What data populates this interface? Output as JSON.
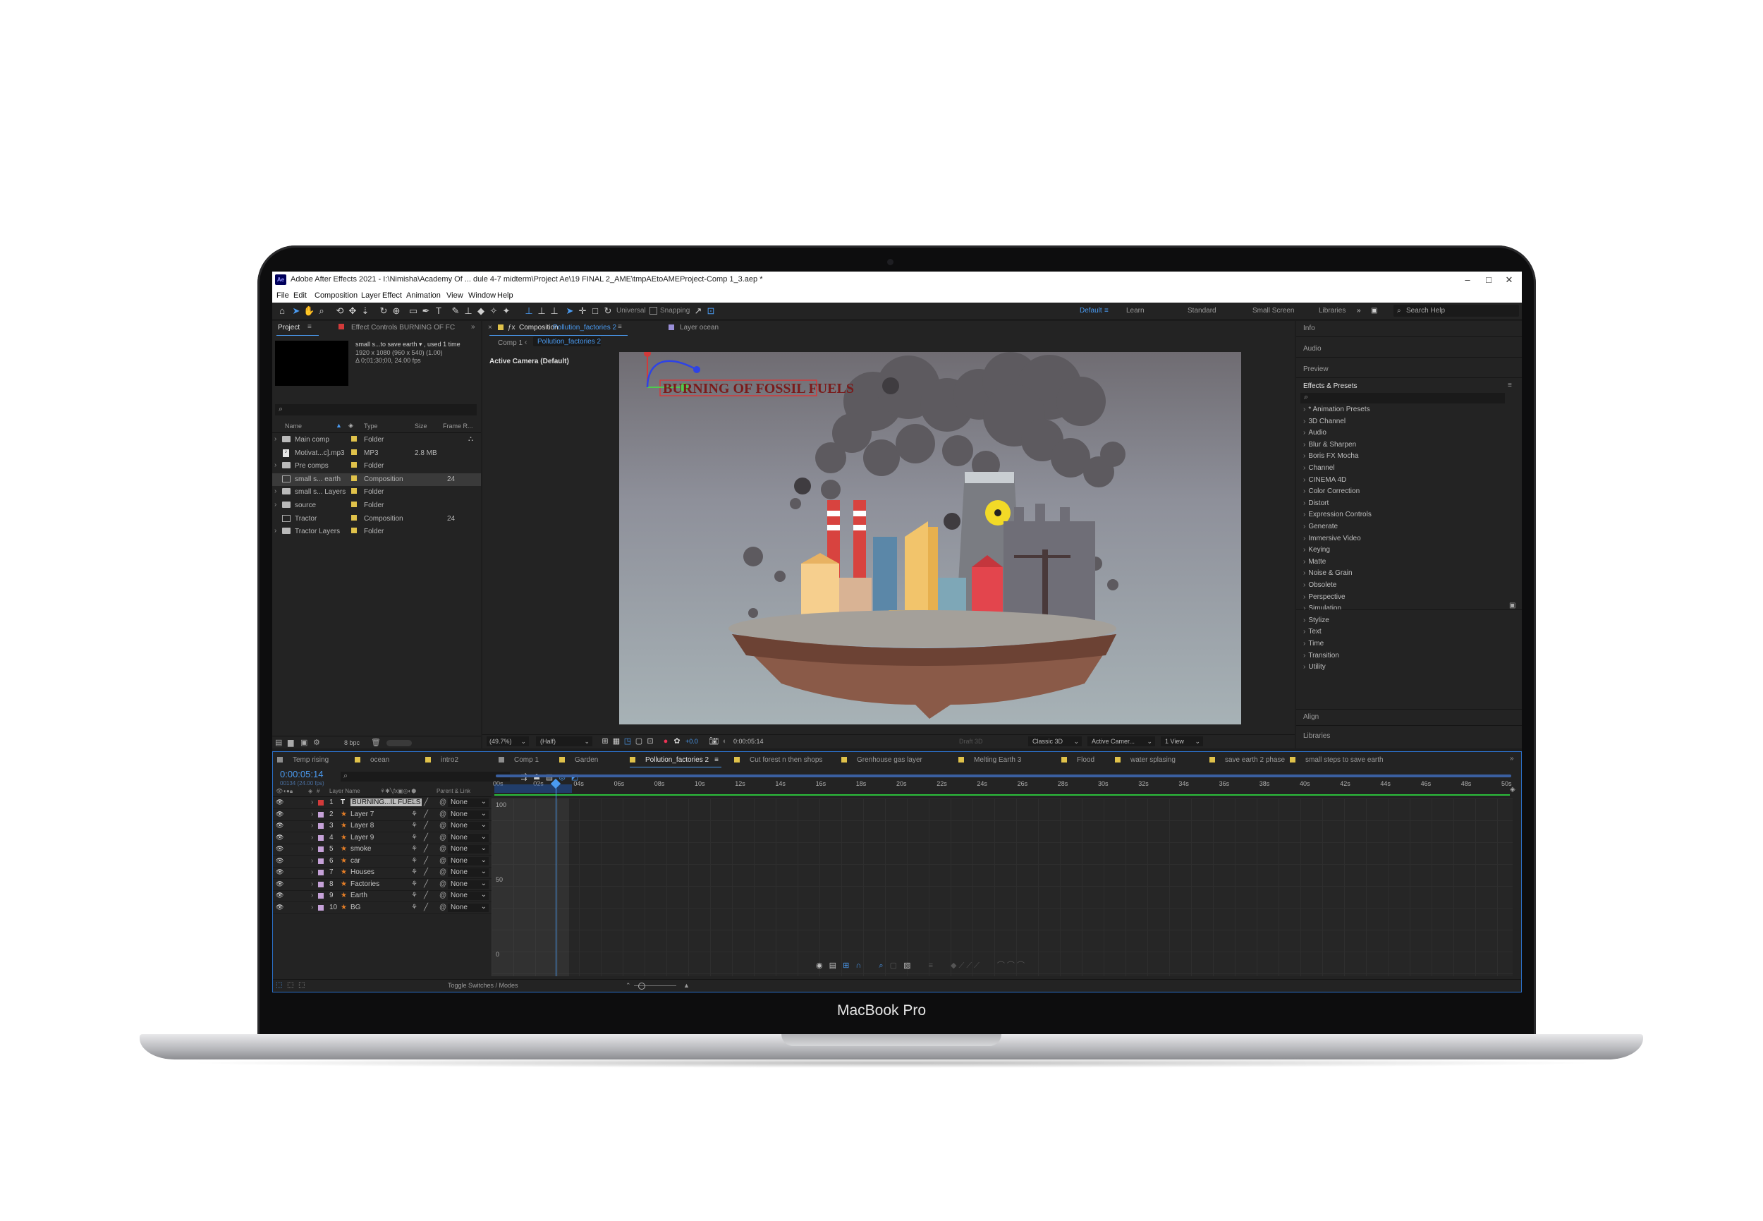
{
  "device": {
    "label": "MacBook Pro"
  },
  "window": {
    "app_icon": "Ae",
    "title": "Adobe After Effects 2021 - I:\\Nimisha\\Academy Of ... dule 4-7 midterm\\Project Ae\\19 FINAL 2_AME\\tmpAEtoAMEProject-Comp 1_3.aep *",
    "minimize": "–",
    "maximize": "□",
    "close": "✕"
  },
  "menu": [
    "File",
    "Edit",
    "Composition",
    "Layer",
    "Effect",
    "Animation",
    "View",
    "Window",
    "Help"
  ],
  "toolbar": {
    "universal": "Universal",
    "snapping": "Snapping",
    "workspaces": [
      "Default",
      "Learn",
      "Standard",
      "Small Screen",
      "Libraries"
    ],
    "search_placeholder": "Search Help"
  },
  "project": {
    "tab_project": "Project",
    "tab_effect_controls": "Effect Controls BURNING OF FC",
    "info_name": "small s...to save earth ▾ , used 1 time",
    "info_size": "1920 x 1080 (960 x 540) (1.00)",
    "info_duration": "Δ 0;01;30;00, 24.00 fps",
    "columns": [
      "Name",
      "Type",
      "Size",
      "Frame R..."
    ],
    "items": [
      {
        "name": "Main comp",
        "type": "Folder",
        "size": "",
        "rate": "",
        "kind": "folder"
      },
      {
        "name": "Motivat...c].mp3",
        "type": "MP3",
        "size": "2.8 MB",
        "rate": "",
        "kind": "file"
      },
      {
        "name": "Pre comps",
        "type": "Folder",
        "size": "",
        "rate": "",
        "kind": "folder"
      },
      {
        "name": "small s... earth",
        "type": "Composition",
        "size": "",
        "rate": "24",
        "kind": "comp"
      },
      {
        "name": "small s... Layers",
        "type": "Folder",
        "size": "",
        "rate": "",
        "kind": "folder"
      },
      {
        "name": "source",
        "type": "Folder",
        "size": "",
        "rate": "",
        "kind": "folder"
      },
      {
        "name": "Tractor",
        "type": "Composition",
        "size": "",
        "rate": "24",
        "kind": "comp"
      },
      {
        "name": "Tractor Layers",
        "type": "Folder",
        "size": "",
        "rate": "",
        "kind": "folder"
      }
    ],
    "bpc": "8 bpc"
  },
  "composition": {
    "tab_prefix": "Composition",
    "tab_name": "Pollution_factories 2",
    "layer_tab": "Layer ocean",
    "breadcrumb": [
      "Comp 1",
      "Pollution_factories 2"
    ],
    "camera_label": "Active Camera (Default)",
    "artwork_title": "BURNING OF FOSSIL FUELS",
    "zoom": "(49.7%)",
    "resolution": "(Half)",
    "exposure": "+0.0",
    "timecode": "0:00:05:14",
    "draft3d": "Draft 3D",
    "renderer": "Classic 3D",
    "camera_select": "Active Camer...",
    "view_select": "1 View"
  },
  "right_panels": {
    "top": [
      "Info",
      "Audio",
      "Preview"
    ],
    "effects_title": "Effects & Presets",
    "effects": [
      "* Animation Presets",
      "3D Channel",
      "Audio",
      "Blur & Sharpen",
      "Boris FX Mocha",
      "Channel",
      "CINEMA 4D",
      "Color Correction",
      "Distort",
      "Expression Controls",
      "Generate",
      "Immersive Video",
      "Keying",
      "Matte",
      "Noise & Grain",
      "Obsolete",
      "Perspective",
      "Simulation",
      "Stylize",
      "Text",
      "Time",
      "Transition",
      "Utility"
    ],
    "bottom": [
      "Align",
      "Libraries"
    ]
  },
  "timeline": {
    "tabs": [
      {
        "label": "Temp rising",
        "color": "#8d8d8d"
      },
      {
        "label": "ocean",
        "color": "#e0c24a"
      },
      {
        "label": "intro2",
        "color": "#e0c24a"
      },
      {
        "label": "Comp 1",
        "color": "#8d8d8d"
      },
      {
        "label": "Garden",
        "color": "#e0c24a"
      },
      {
        "label": "Pollution_factories 2",
        "color": "#e0c24a"
      },
      {
        "label": "Cut forest n then shops",
        "color": "#e0c24a"
      },
      {
        "label": "Grenhouse gas layer",
        "color": "#e0c24a"
      },
      {
        "label": "Melting Earth 3",
        "color": "#e0c24a"
      },
      {
        "label": "Flood",
        "color": "#e0c24a"
      },
      {
        "label": "water splasing",
        "color": "#e0c24a"
      },
      {
        "label": "save earth 2 phase",
        "color": "#e0c24a"
      },
      {
        "label": "small steps to save earth",
        "color": "#e0c24a"
      }
    ],
    "timecode": "0:00:05:14",
    "frames": "00134 (24.00 fps)",
    "col_layer_name": "Layer Name",
    "col_parent": "Parent & Link",
    "ruler": [
      "00s",
      "02s",
      "04s",
      "06s",
      "08s",
      "10s",
      "12s",
      "14s",
      "16s",
      "18s",
      "20s",
      "22s",
      "24s",
      "26s",
      "28s",
      "30s",
      "32s",
      "34s",
      "36s",
      "38s",
      "40s",
      "42s",
      "44s",
      "46s",
      "48s",
      "50s"
    ],
    "graph_labels": [
      "100",
      "50",
      "0"
    ],
    "layers": [
      {
        "num": "1",
        "name": "BURNING...IL FUELS",
        "color": "#d23a3a",
        "kind": "text",
        "parent": "None"
      },
      {
        "num": "2",
        "name": "Layer 7",
        "color": "#c5a1d8",
        "kind": "shape",
        "parent": "None"
      },
      {
        "num": "3",
        "name": "Layer 8",
        "color": "#c5a1d8",
        "kind": "shape",
        "parent": "None"
      },
      {
        "num": "4",
        "name": "Layer 9",
        "color": "#c5a1d8",
        "kind": "shape",
        "parent": "None"
      },
      {
        "num": "5",
        "name": "smoke",
        "color": "#c5a1d8",
        "kind": "shape",
        "parent": "None"
      },
      {
        "num": "6",
        "name": "car",
        "color": "#c5a1d8",
        "kind": "shape",
        "parent": "None"
      },
      {
        "num": "7",
        "name": "Houses",
        "color": "#c5a1d8",
        "kind": "shape",
        "parent": "None"
      },
      {
        "num": "8",
        "name": "Factories",
        "color": "#c5a1d8",
        "kind": "shape",
        "parent": "None"
      },
      {
        "num": "9",
        "name": "Earth",
        "color": "#c5a1d8",
        "kind": "shape",
        "parent": "None"
      },
      {
        "num": "10",
        "name": "BG",
        "color": "#c5a1d8",
        "kind": "shape",
        "parent": "None"
      }
    ],
    "toggle_label": "Toggle Switches / Modes"
  }
}
